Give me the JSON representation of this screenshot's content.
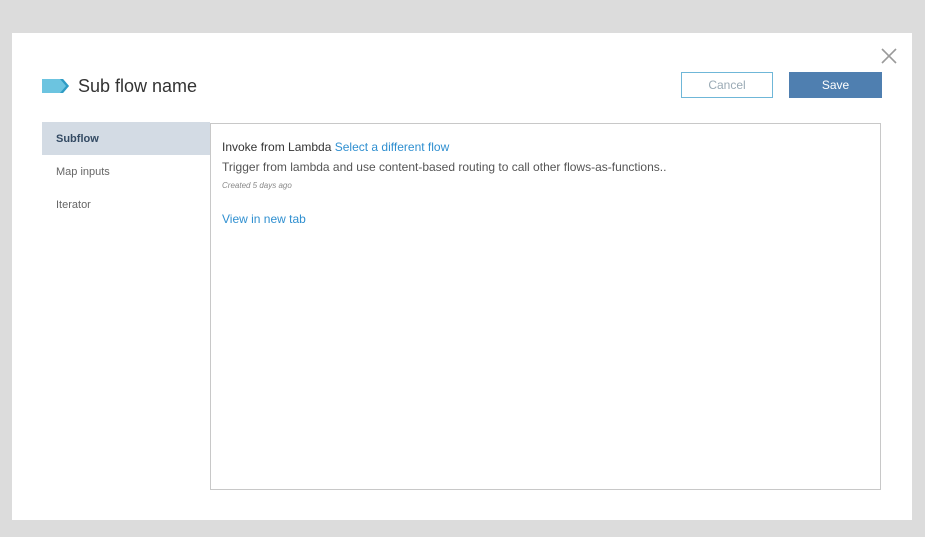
{
  "dialog": {
    "title": "Sub flow name",
    "cancel_label": "Cancel",
    "save_label": "Save",
    "close_icon": "close-icon",
    "title_icon": "flow-tag-icon",
    "colors": {
      "accent": "#4f7fb0",
      "link": "#2f8fd0",
      "title_icon": "#6cc4e0",
      "sidebar_active": "#d3dbe4"
    }
  },
  "sidebar": {
    "items": [
      {
        "label": "Subflow",
        "active": true
      },
      {
        "label": "Map inputs",
        "active": false
      },
      {
        "label": "Iterator",
        "active": false
      }
    ]
  },
  "flow": {
    "name": "Invoke from Lambda",
    "change_link": "Select a different flow",
    "description": "Trigger from lambda and use content-based routing to call other flows-as-functions..",
    "created": "Created 5 days ago",
    "view_link": "View in new tab"
  }
}
